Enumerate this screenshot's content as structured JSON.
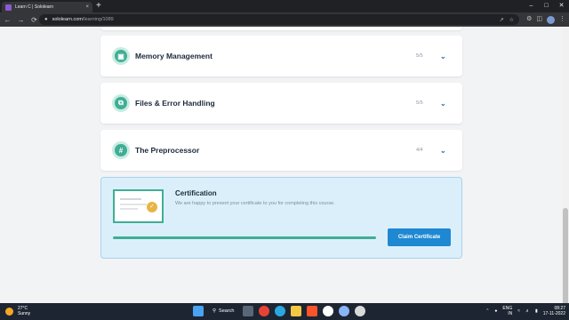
{
  "browser": {
    "tab_title": "Learn C | Sololearn",
    "tab_close": "×",
    "new_tab": "+",
    "url_host": "sololearn.com",
    "url_path": "/learning/1089",
    "window_controls": [
      "–",
      "□",
      "✕"
    ],
    "nav": {
      "back": "←",
      "forward": "→",
      "reload": "⟳",
      "lock": "🔒"
    }
  },
  "modules": [
    {
      "icon": "memory-icon",
      "symbol": "▣",
      "title": "Memory Management",
      "progress": "5/5"
    },
    {
      "icon": "files-icon",
      "symbol": "⧉",
      "title": "Files & Error Handling",
      "progress": "5/5"
    },
    {
      "icon": "hash-icon",
      "symbol": "#",
      "title": "The Preprocessor",
      "progress": "4/4"
    }
  ],
  "certification": {
    "title": "Certification",
    "description": "We are happy to present your certificate to you for completing this course.",
    "progress_fraction": 1.0,
    "button_label": "Claim Certificate"
  },
  "colors": {
    "accent_green": "#3fae94",
    "button_blue": "#1e88d3",
    "cert_bg": "#dbeffb"
  },
  "taskbar": {
    "temperature": "27°C",
    "weather": "Sunny",
    "search_label": "Search",
    "language": "ENG",
    "region": "IN",
    "time": "08:27",
    "date": "17-11-2022"
  }
}
